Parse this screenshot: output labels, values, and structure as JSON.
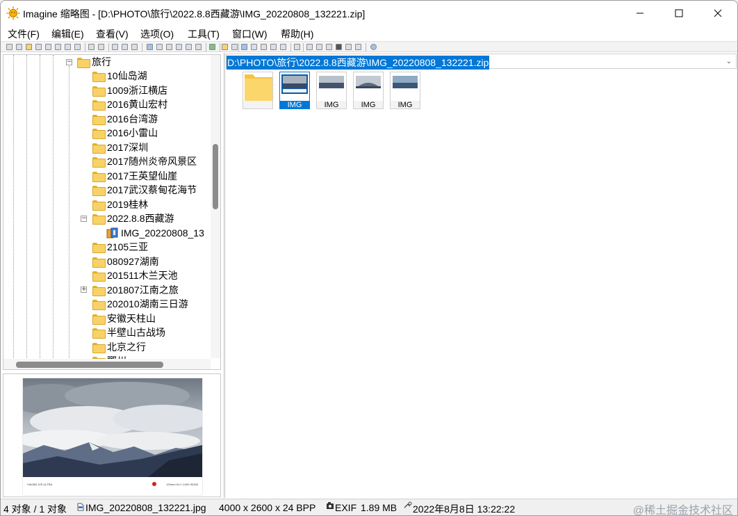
{
  "window": {
    "title": "Imagine 缩略图 - [D:\\PHOTO\\旅行\\2022.8.8西藏游\\IMG_20220808_132221.zip]",
    "minimize_glyph": "—",
    "maximize_glyph": "☐",
    "close_glyph": "✕"
  },
  "menu": [
    "文件(F)",
    "编辑(E)",
    "查看(V)",
    "选项(O)",
    "工具(T)",
    "窗口(W)",
    "帮助(H)"
  ],
  "tree": {
    "root": "旅行",
    "items": [
      "10仙岛湖",
      "1009浙江横店",
      "2016黄山宏村",
      "2016台湾游",
      "2016小雷山",
      "2017深圳",
      "2017随州炎帝风景区",
      "2017王英望仙崖",
      "2017武汉蔡甸花海节",
      "2019桂林",
      "2022.8.8西藏游",
      "IMG_20220808_13",
      "2105三亚",
      "080927湖南",
      "201511木兰天池",
      "201807江南之旅",
      "202010湖南三日游",
      "安徽天柱山",
      "半壁山古战场",
      "北京之行",
      "鄂州"
    ],
    "expanded_marker": "−",
    "collapsed_marker": "+"
  },
  "preview": {
    "camera_text": "XIAOMI 12S ULTRA",
    "exif_text": "120mm f/4.1 1/400 ISO50"
  },
  "address": {
    "path": "D:\\PHOTO\\旅行\\2022.8.8西藏游\\IMG_20220808_132221.zip",
    "dropdown": "⌄"
  },
  "thumbnails": [
    "",
    "IMG",
    "IMG",
    "IMG",
    "IMG"
  ],
  "status": {
    "count": "4 对象 / 1 对象",
    "filename": "IMG_20220808_132221.jpg",
    "dimensions": "4000 x 2600 x 24 BPP",
    "exif": "EXIF",
    "filesize": "1.89 MB",
    "datetime": "2022年8月8日 13:22:22",
    "watermark": "@稀土掘金技术社区"
  },
  "colors": {
    "selection": "#0078d7",
    "folder": "#f8d267"
  }
}
